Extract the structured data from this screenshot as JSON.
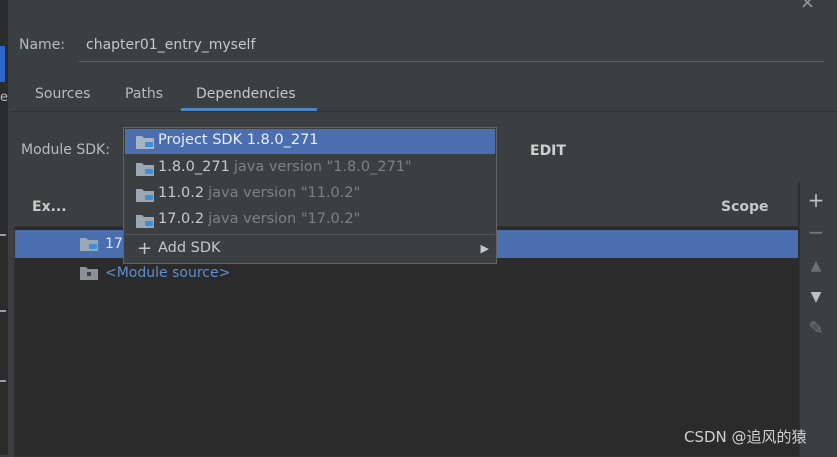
{
  "dialog": {
    "close_glyph": "×"
  },
  "left_hint": {
    "letter": "e"
  },
  "name": {
    "label": "Name:",
    "value": "chapter01_entry_myself"
  },
  "tabs": [
    {
      "label": "Sources",
      "active": false
    },
    {
      "label": "Paths",
      "active": false
    },
    {
      "label": "Dependencies",
      "active": true
    }
  ],
  "module_sdk": {
    "label": "Module SDK:",
    "edit_label": "EDIT"
  },
  "table": {
    "col_export": "Ex...",
    "col_scope": "Scope",
    "rows": [
      {
        "text": "17",
        "icon": "folder-icon",
        "selected": true
      },
      {
        "text": "<Module source>",
        "icon": "folder-icon",
        "selected": false
      }
    ]
  },
  "toolbar": {
    "add": "+",
    "remove": "−",
    "up": "▲",
    "down": "▼",
    "edit": "✎"
  },
  "sdk_dropdown": {
    "items": [
      {
        "name": "Project SDK 1.8.0_271",
        "version": "",
        "selected": true
      },
      {
        "name": "1.8.0_271",
        "version": "java version \"1.8.0_271\"",
        "selected": false
      },
      {
        "name": "11.0.2",
        "version": "java version \"11.0.2\"",
        "selected": false
      },
      {
        "name": "17.0.2",
        "version": "java version \"17.0.2\"",
        "selected": false
      }
    ],
    "add_sdk": "Add SDK"
  },
  "watermark": "CSDN @追风的猿",
  "colors": {
    "accent": "#4a88c7",
    "selection": "#4b6eaf",
    "background": "#3c3f41"
  }
}
